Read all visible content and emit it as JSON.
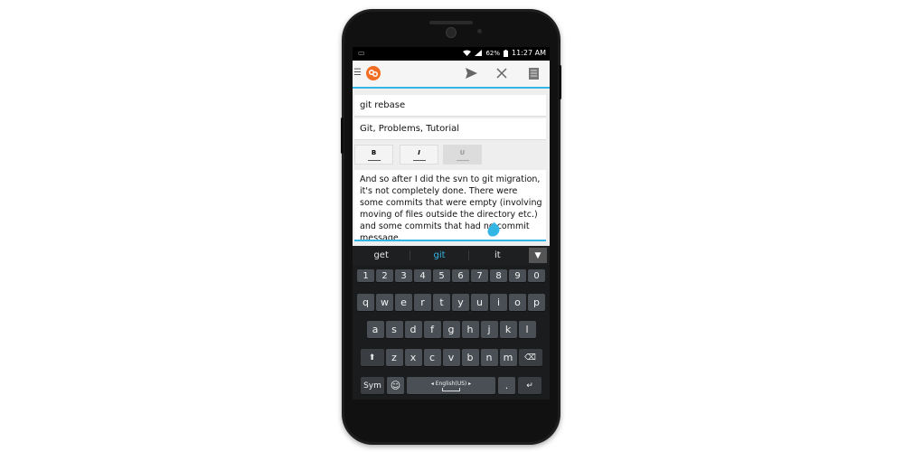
{
  "status_bar": {
    "left_icon": "voicemail-icon",
    "battery": "62%",
    "time": "11:27 AM"
  },
  "app_bar": {
    "drawer_icon": "menu-icon",
    "logo": "app-logo",
    "send_icon": "send-icon",
    "close_icon": "close-icon",
    "notes_icon": "notes-icon"
  },
  "editor": {
    "title": "git rebase",
    "tags": "Git, Problems, Tutorial",
    "format_buttons": {
      "bold": "B",
      "italic": "I",
      "underline": "U"
    },
    "body": "And so after I did the svn to git migration, it's not completely done. There were some commits that were empty (involving moving of files outside the directory etc.) and some commits that had no commit message."
  },
  "suggestions": {
    "items": [
      "get",
      "git",
      "it"
    ],
    "highlighted": "git"
  },
  "keyboard": {
    "numbers": [
      "1",
      "2",
      "3",
      "4",
      "5",
      "6",
      "7",
      "8",
      "9",
      "0"
    ],
    "row1": [
      "q",
      "w",
      "e",
      "r",
      "t",
      "y",
      "u",
      "i",
      "o",
      "p"
    ],
    "row2": [
      "a",
      "s",
      "d",
      "f",
      "g",
      "h",
      "j",
      "k",
      "l"
    ],
    "row3": [
      "z",
      "x",
      "c",
      "v",
      "b",
      "n",
      "m"
    ],
    "sym": "Sym",
    "space_label": "◂ English(US) ▸",
    "period": "."
  },
  "colors": {
    "accent": "#33b5e5",
    "logo": "#f26d21"
  }
}
